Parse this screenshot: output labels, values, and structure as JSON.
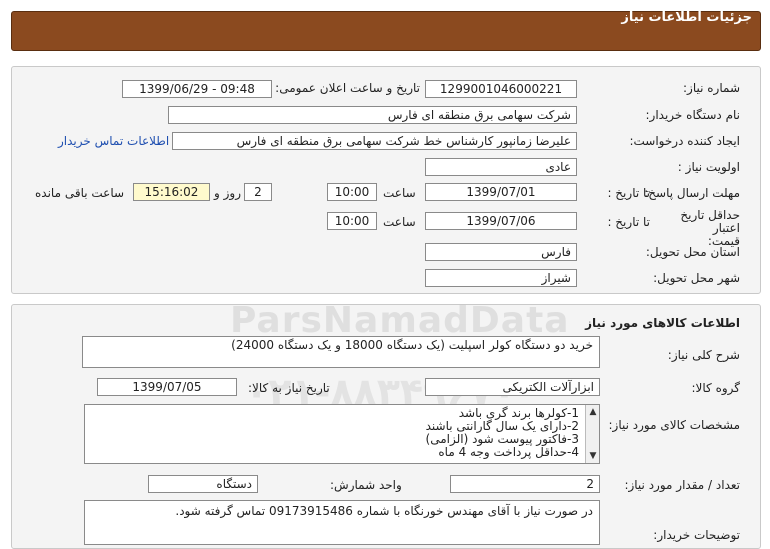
{
  "header": {
    "title": "جزئیات اطلاعات نیاز"
  },
  "form": {
    "need_number_label": "شماره نیاز:",
    "need_number": "1299001046000221",
    "announce_label": "تاریخ و ساعت اعلان عمومی:",
    "announce_value": "1399/06/29 - 09:48",
    "buyer_org_label": "نام دستگاه خریدار:",
    "buyer_org": "شرکت سهامی برق منطقه ای فارس",
    "requester_label": "ایجاد کننده درخواست:",
    "requester": "علیرضا زمانپور کارشناس خط شرکت سهامی برق منطقه ای فارس",
    "contact_link": "اطلاعات تماس خریدار",
    "priority_label": "اولویت نیاز :",
    "priority": "عادی",
    "deadline_label": "مهلت ارسال پاسخ:",
    "until_date_label": "تا تاریخ :",
    "deadline_date": "1399/07/01",
    "time_label": "ساعت",
    "deadline_time": "10:00",
    "days_value": "2",
    "days_label": "روز و",
    "remaining_time": "15:16:02",
    "remaining_label": "ساعت باقی مانده",
    "validity_label": "حداقل تاریخ اعتبار قیمت:",
    "validity_date": "1399/07/06",
    "validity_time": "10:00",
    "province_label": "استان محل تحویل:",
    "province": "فارس",
    "city_label": "شهر محل تحویل:",
    "city": "شیراز"
  },
  "goods": {
    "section_title": "اطلاعات کالاهای مورد نیاز",
    "description_label": "شرح کلی نیاز:",
    "description": "خرید دو دستگاه کولر اسپلیت (یک دستگاه 18000 و یک دستگاه 24000)",
    "group_label": "گروه کالا:",
    "group": "ابزارآلات الکتریکی",
    "need_date_label": "تاریخ نیاز به کالا:",
    "need_date": "1399/07/05",
    "specs_label": "مشخصات کالای مورد نیاز:",
    "specs": [
      "1-کولرها برند گری باشد",
      "2-دارای یک سال گارانتی باشند",
      "3-فاکتور پیوست شود (الزامی)",
      "4-حداقل پرداخت وجه 4 ماه"
    ],
    "quantity_label": "تعداد / مقدار مورد نیاز:",
    "quantity": "2",
    "unit_label": "واحد شمارش:",
    "unit": "دستگاه",
    "buyer_notes_label": "توضیحات خریدار:",
    "buyer_notes": "در صورت نیاز با آقای مهندس خورنگاه با شماره 09173915486 تماس گرفته شود."
  },
  "watermark": {
    "line1": "ParsNamadData",
    "line2": "۰۲۱-۸۸۳۴۹۶۷۰"
  }
}
